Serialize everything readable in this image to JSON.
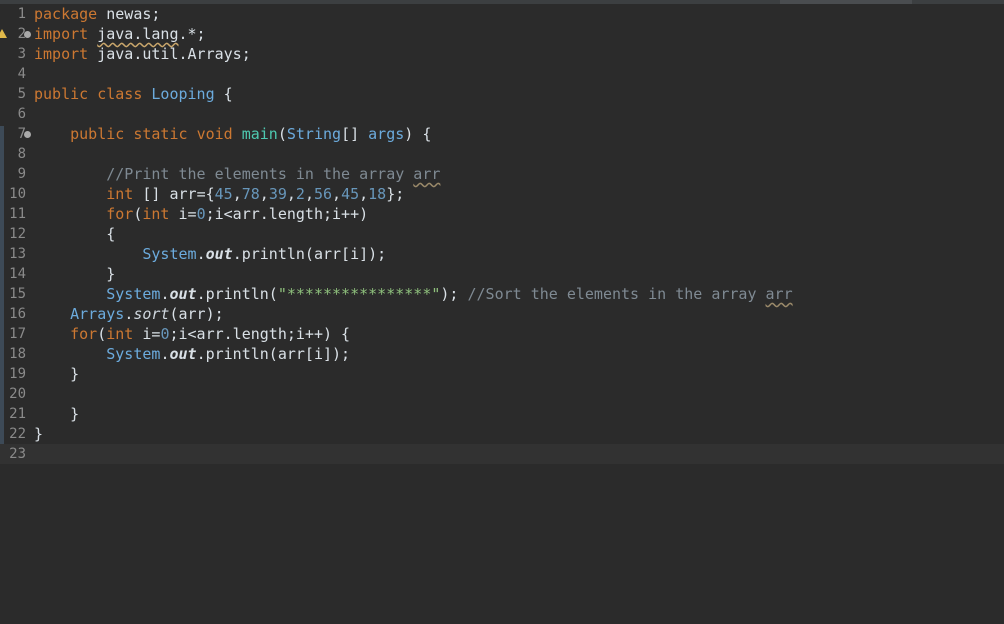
{
  "editor": {
    "file_class": "Looping",
    "lines": [
      {
        "num": "1",
        "tokens": [
          {
            "t": "package ",
            "c": "kw"
          },
          {
            "t": "newas;",
            "c": ""
          }
        ]
      },
      {
        "num": "2",
        "tokens": [
          {
            "t": "import ",
            "c": "kw"
          },
          {
            "t": "java.lang",
            "c": "wavy"
          },
          {
            "t": ".*;",
            "c": ""
          }
        ]
      },
      {
        "num": "3",
        "tokens": [
          {
            "t": "import ",
            "c": "kw"
          },
          {
            "t": "java.util.Arrays;",
            "c": ""
          }
        ]
      },
      {
        "num": "4",
        "tokens": []
      },
      {
        "num": "5",
        "tokens": [
          {
            "t": "public ",
            "c": "kw"
          },
          {
            "t": "class ",
            "c": "kw"
          },
          {
            "t": "Looping",
            "c": "cls"
          },
          {
            "t": " {",
            "c": ""
          }
        ]
      },
      {
        "num": "6",
        "tokens": []
      },
      {
        "num": "7",
        "tokens": [
          {
            "t": "    ",
            "c": ""
          },
          {
            "t": "public ",
            "c": "kw"
          },
          {
            "t": "static ",
            "c": "kw"
          },
          {
            "t": "void ",
            "c": "kw"
          },
          {
            "t": "main",
            "c": "mth"
          },
          {
            "t": "(",
            "c": ""
          },
          {
            "t": "String",
            "c": "cls"
          },
          {
            "t": "[] ",
            "c": ""
          },
          {
            "t": "args",
            "c": "cls"
          },
          {
            "t": ") {",
            "c": ""
          }
        ]
      },
      {
        "num": "8",
        "tokens": []
      },
      {
        "num": "9",
        "tokens": [
          {
            "t": "        ",
            "c": ""
          },
          {
            "t": "//Print the elements in the array ",
            "c": "cmt"
          },
          {
            "t": "arr",
            "c": "cmt wavyc"
          }
        ]
      },
      {
        "num": "10",
        "tokens": [
          {
            "t": "        ",
            "c": ""
          },
          {
            "t": "int ",
            "c": "kw"
          },
          {
            "t": "[] ",
            "c": ""
          },
          {
            "t": "arr",
            "c": ""
          },
          {
            "t": "={",
            "c": ""
          },
          {
            "t": "45",
            "c": "num"
          },
          {
            "t": ",",
            "c": ""
          },
          {
            "t": "78",
            "c": "num"
          },
          {
            "t": ",",
            "c": ""
          },
          {
            "t": "39",
            "c": "num"
          },
          {
            "t": ",",
            "c": ""
          },
          {
            "t": "2",
            "c": "num"
          },
          {
            "t": ",",
            "c": ""
          },
          {
            "t": "56",
            "c": "num"
          },
          {
            "t": ",",
            "c": ""
          },
          {
            "t": "45",
            "c": "num"
          },
          {
            "t": ",",
            "c": ""
          },
          {
            "t": "18",
            "c": "num"
          },
          {
            "t": "};",
            "c": ""
          }
        ]
      },
      {
        "num": "11",
        "tokens": [
          {
            "t": "        ",
            "c": ""
          },
          {
            "t": "for",
            "c": "kw"
          },
          {
            "t": "(",
            "c": ""
          },
          {
            "t": "int ",
            "c": "kw"
          },
          {
            "t": "i=",
            "c": ""
          },
          {
            "t": "0",
            "c": "num"
          },
          {
            "t": ";i<arr.length;i++)",
            "c": ""
          }
        ]
      },
      {
        "num": "12",
        "tokens": [
          {
            "t": "        {",
            "c": ""
          }
        ]
      },
      {
        "num": "13",
        "tokens": [
          {
            "t": "            ",
            "c": ""
          },
          {
            "t": "System",
            "c": "cls"
          },
          {
            "t": ".",
            "c": ""
          },
          {
            "t": "out",
            "c": "fld"
          },
          {
            "t": ".println(arr[i]);",
            "c": ""
          }
        ]
      },
      {
        "num": "14",
        "tokens": [
          {
            "t": "        }",
            "c": ""
          }
        ]
      },
      {
        "num": "15",
        "tokens": [
          {
            "t": "        ",
            "c": ""
          },
          {
            "t": "System",
            "c": "cls"
          },
          {
            "t": ".",
            "c": ""
          },
          {
            "t": "out",
            "c": "fld"
          },
          {
            "t": ".println(",
            "c": ""
          },
          {
            "t": "\"****************\"",
            "c": "str"
          },
          {
            "t": "); ",
            "c": ""
          },
          {
            "t": "//Sort the elements in the array ",
            "c": "cmt"
          },
          {
            "t": "arr",
            "c": "cmt wavyc"
          }
        ]
      },
      {
        "num": "16",
        "tokens": [
          {
            "t": "    ",
            "c": ""
          },
          {
            "t": "Arrays",
            "c": "cls"
          },
          {
            "t": ".",
            "c": ""
          },
          {
            "t": "sort",
            "c": "smth"
          },
          {
            "t": "(arr);",
            "c": ""
          }
        ]
      },
      {
        "num": "17",
        "tokens": [
          {
            "t": "    ",
            "c": ""
          },
          {
            "t": "for",
            "c": "kw"
          },
          {
            "t": "(",
            "c": ""
          },
          {
            "t": "int ",
            "c": "kw"
          },
          {
            "t": "i=",
            "c": ""
          },
          {
            "t": "0",
            "c": "num"
          },
          {
            "t": ";i<arr.length;i++) {",
            "c": ""
          }
        ]
      },
      {
        "num": "18",
        "tokens": [
          {
            "t": "        ",
            "c": ""
          },
          {
            "t": "System",
            "c": "cls"
          },
          {
            "t": ".",
            "c": ""
          },
          {
            "t": "out",
            "c": "fld"
          },
          {
            "t": ".println(arr[i]);",
            "c": ""
          }
        ]
      },
      {
        "num": "19",
        "tokens": [
          {
            "t": "    }",
            "c": ""
          }
        ]
      },
      {
        "num": "20",
        "tokens": []
      },
      {
        "num": "21",
        "tokens": [
          {
            "t": "    }",
            "c": ""
          }
        ]
      },
      {
        "num": "22",
        "tokens": [
          {
            "t": "}",
            "c": ""
          }
        ]
      },
      {
        "num": "23",
        "tokens": []
      }
    ],
    "fold_lines": [
      "2",
      "7"
    ],
    "warning_line": "2",
    "current_line": "23"
  }
}
